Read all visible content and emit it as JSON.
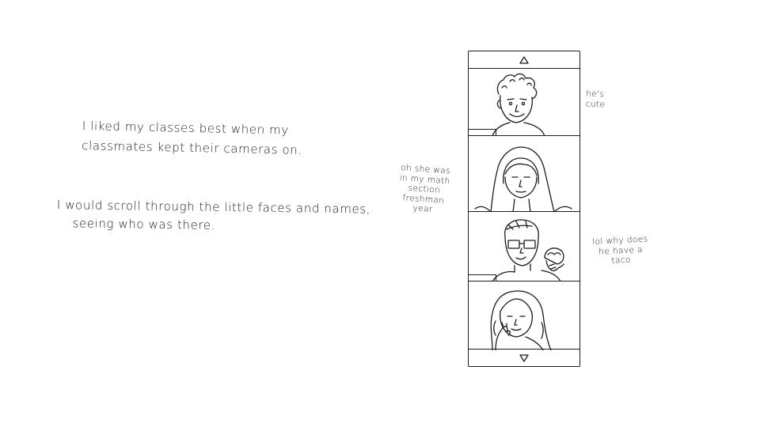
{
  "narration": {
    "para1": {
      "line1": "I  liked  my  classes  best  when  my",
      "line2": "classmates  kept  their  cameras  on."
    },
    "para2": {
      "line1": "I would  scroll  through  the  little  faces  and names,",
      "line2": "seeing  who  was  there."
    }
  },
  "comments": {
    "tile1": [
      "he's",
      "cute"
    ],
    "tile2": [
      "oh she was",
      "in my math",
      "section",
      "freshman",
      "year"
    ],
    "tile3": [
      "lol why does",
      "he  have  a",
      "taco"
    ]
  },
  "strip": {
    "scroll_up_icon": "triangle-up-icon",
    "scroll_down_icon": "triangle-down-icon",
    "tiles": [
      {
        "person": "curly-haired boy smiling"
      },
      {
        "person": "girl in hoodie"
      },
      {
        "person": "boy with glasses holding taco"
      },
      {
        "person": "girl with long hair resting head on hand"
      }
    ]
  },
  "colors": {
    "ink": "#1c1c1c",
    "paper": "#ffffff"
  }
}
